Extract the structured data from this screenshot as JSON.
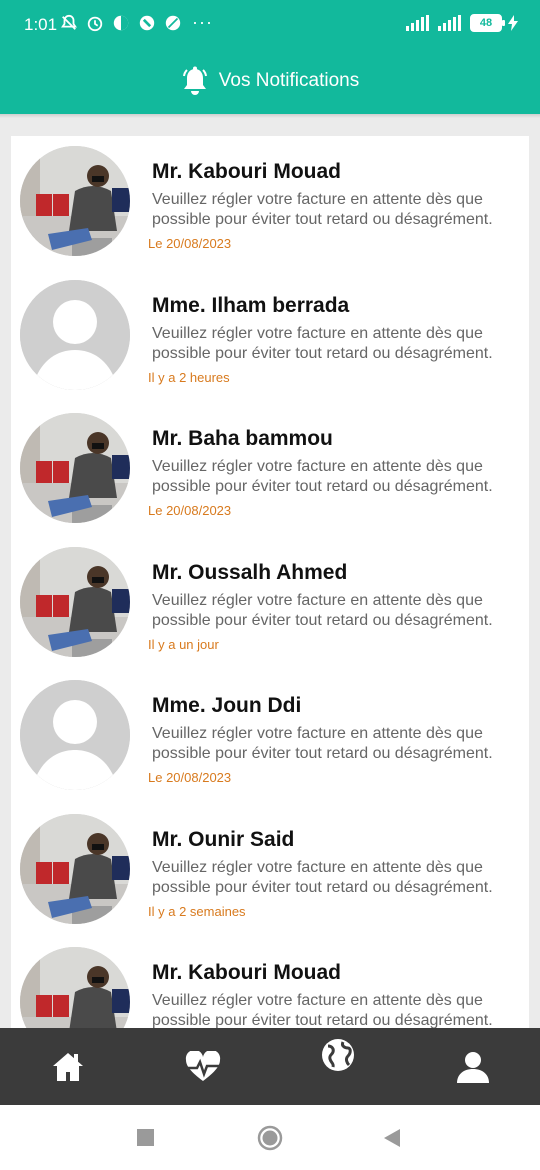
{
  "status_bar": {
    "time": "1:01",
    "dots": "···",
    "battery": "48"
  },
  "header": {
    "title": "Vos Notifications",
    "icon": "bell-icon"
  },
  "notifications": [
    {
      "name": "Mr. Kabouri Mouad",
      "message": "Veuillez régler votre facture en attente dès que possible pour éviter tout retard ou désagrément.",
      "date": "Le 20/08/2023",
      "avatar": "photo"
    },
    {
      "name": "Mme. Ilham berrada",
      "message": "Veuillez régler votre facture en attente dès que possible pour éviter tout retard ou désagrément.",
      "date": "Il y a 2 heures",
      "avatar": "placeholder"
    },
    {
      "name": "Mr. Baha bammou",
      "message": "Veuillez régler votre facture en attente dès que possible pour éviter tout retard ou désagrément.",
      "date": "Le 20/08/2023",
      "avatar": "photo"
    },
    {
      "name": "Mr. Oussalh Ahmed",
      "message": "Veuillez régler votre facture en attente dès que possible pour éviter tout retard ou désagrément.",
      "date": "Il y a un jour",
      "avatar": "photo"
    },
    {
      "name": "Mme. Joun Ddi",
      "message": "Veuillez régler votre facture en attente dès que possible pour éviter tout retard ou désagrément.",
      "date": "Le 20/08/2023",
      "avatar": "placeholder"
    },
    {
      "name": "Mr. Ounir Said",
      "message": "Veuillez régler votre facture en attente dès que possible pour éviter tout retard ou désagrément.",
      "date": "Il y a 2 semaines",
      "avatar": "photo"
    },
    {
      "name": "Mr. Kabouri Mouad",
      "message": "Veuillez régler votre facture en attente dès que possible pour éviter tout retard ou désagrément.",
      "date": "",
      "avatar": "photo"
    }
  ],
  "tab_bar": [
    {
      "icon": "home-icon"
    },
    {
      "icon": "heart-pulse-icon"
    },
    {
      "icon": "globe-icon"
    },
    {
      "icon": "user-icon"
    }
  ],
  "colors": {
    "primary": "#12b99c",
    "date": "#d87a1e",
    "tabbar": "#3b3b3b"
  }
}
